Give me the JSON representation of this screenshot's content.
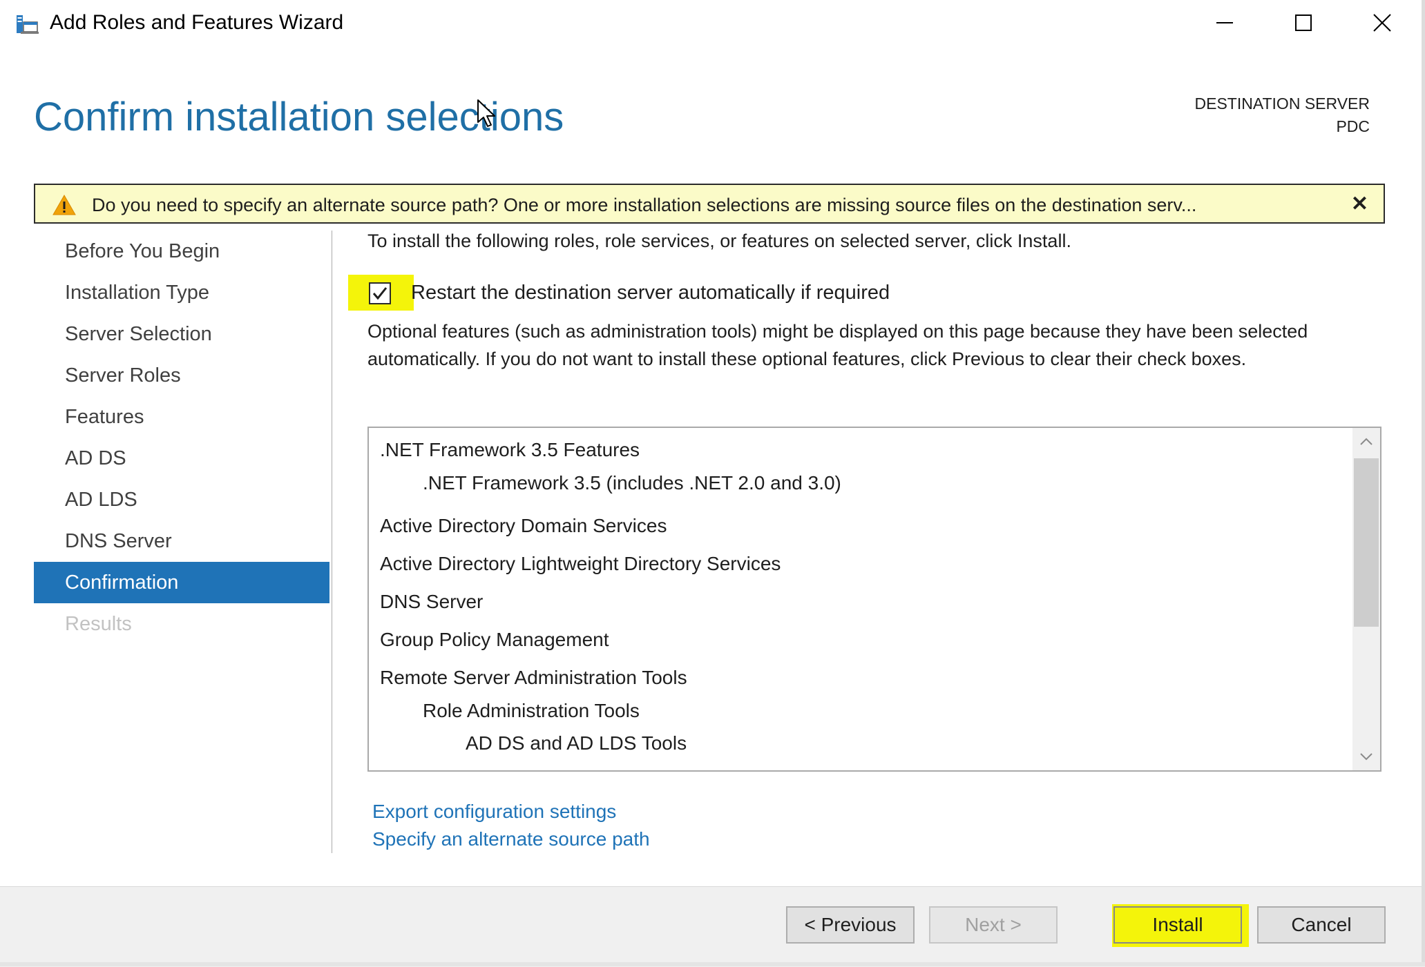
{
  "window": {
    "title": "Add Roles and Features Wizard"
  },
  "header": {
    "title": "Confirm installation selections",
    "destination_label": "DESTINATION SERVER",
    "destination_server": "PDC"
  },
  "warning": {
    "text": "Do you need to specify an alternate source path? One or more installation selections are missing source files on the destination serv...",
    "close": "✕"
  },
  "sidebar": {
    "items": [
      {
        "label": "Before You Begin",
        "state": "normal"
      },
      {
        "label": "Installation Type",
        "state": "normal"
      },
      {
        "label": "Server Selection",
        "state": "normal"
      },
      {
        "label": "Server Roles",
        "state": "normal"
      },
      {
        "label": "Features",
        "state": "normal"
      },
      {
        "label": "AD DS",
        "state": "normal"
      },
      {
        "label": "AD LDS",
        "state": "normal"
      },
      {
        "label": "DNS Server",
        "state": "normal"
      },
      {
        "label": "Confirmation",
        "state": "active"
      },
      {
        "label": "Results",
        "state": "disabled"
      }
    ]
  },
  "main": {
    "intro": "To install the following roles, role services, or features on selected server, click Install.",
    "restart_checkbox": {
      "label": "Restart the destination server automatically if required",
      "checked": true
    },
    "optional_note": "Optional features (such as administration tools) might be displayed on this page because they have been selected automatically. If you do not want to install these optional features, click Previous to clear their check boxes.",
    "selections": [
      {
        "label": ".NET Framework 3.5 Features",
        "level": 0
      },
      {
        "label": ".NET Framework 3.5 (includes .NET 2.0 and 3.0)",
        "level": 1
      },
      {
        "label": "Active Directory Domain Services",
        "level": 0
      },
      {
        "label": "Active Directory Lightweight Directory Services",
        "level": 0
      },
      {
        "label": "DNS Server",
        "level": 0
      },
      {
        "label": "Group Policy Management",
        "level": 0
      },
      {
        "label": "Remote Server Administration Tools",
        "level": 0
      },
      {
        "label": "Role Administration Tools",
        "level": 1
      },
      {
        "label": "AD DS and AD LDS Tools",
        "level": 2
      }
    ],
    "links": {
      "export": "Export configuration settings",
      "alternate_source": "Specify an alternate source path"
    }
  },
  "footer": {
    "previous": "< Previous",
    "next": "Next >",
    "install": "Install",
    "cancel": "Cancel"
  },
  "colors": {
    "accent": "#1f73b7",
    "heading": "#1f6fa6",
    "warning_bg": "#fbfbc8",
    "highlight": "#f4f40a"
  }
}
